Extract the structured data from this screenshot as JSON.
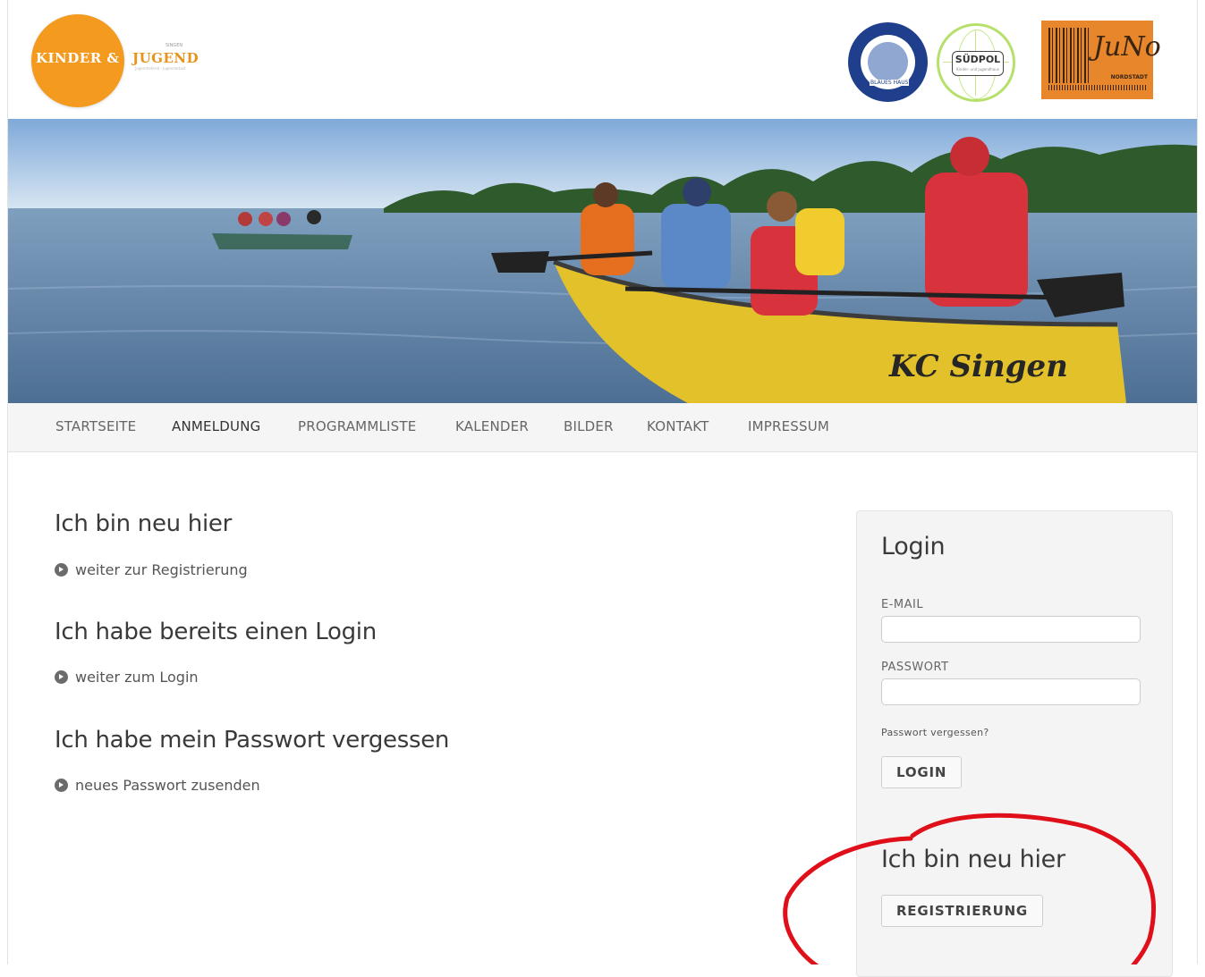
{
  "header": {
    "logo": {
      "kinder": "KINDER &",
      "jugend": "JUGEND",
      "small_top": "SINGEN",
      "small_bottom": "Jugendreferat · Jugendarbeit"
    },
    "partners": {
      "blau": "BLAUES HAUS",
      "suedpol": "SÜDPOL",
      "suedpol_small": "Kinder- und Jugendhaus",
      "juno_script": "JuNo",
      "juno_small": "NORDSTADT"
    }
  },
  "hero": {
    "boat_text": "KC Singen"
  },
  "nav": {
    "items": [
      {
        "label": "STARTSEITE",
        "active": false
      },
      {
        "label": "ANMELDUNG",
        "active": true
      },
      {
        "label": "PROGRAMMLISTE",
        "active": false
      },
      {
        "label": "KALENDER",
        "active": false
      },
      {
        "label": "BILDER",
        "active": false
      },
      {
        "label": "KONTAKT",
        "active": false
      },
      {
        "label": "IMPRESSUM",
        "active": false
      }
    ]
  },
  "main": {
    "sections": [
      {
        "heading": "Ich bin neu hier",
        "link": "weiter zur Registrierung"
      },
      {
        "heading": "Ich habe bereits einen Login",
        "link": "weiter zum Login"
      },
      {
        "heading": "Ich habe mein Passwort vergessen",
        "link": "neues Passwort zusenden"
      }
    ]
  },
  "sidebar": {
    "login_title": "Login",
    "email_label": "E-MAIL",
    "email_value": "",
    "password_label": "PASSWORT",
    "password_value": "",
    "forgot_link": "Passwort vergessen?",
    "login_button": "LOGIN",
    "new_title": "Ich bin neu hier",
    "register_button": "REGISTRIERUNG"
  },
  "colors": {
    "orange": "#f39a1f",
    "annotation_red": "#e0101a",
    "nav_bg": "#f5f5f5"
  }
}
